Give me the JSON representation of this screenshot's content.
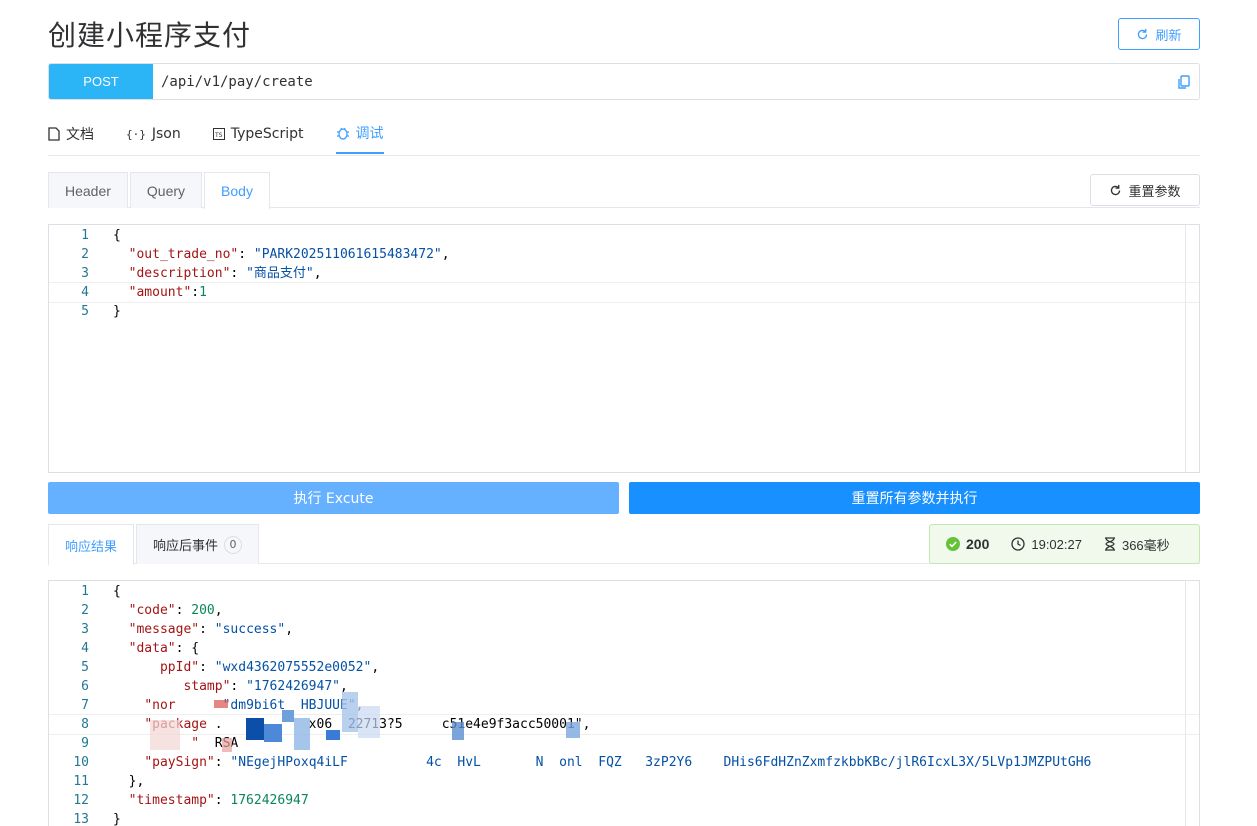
{
  "header": {
    "title": "创建小程序支付",
    "refresh_label": "刷新"
  },
  "request": {
    "method": "POST",
    "url": "/api/v1/pay/create"
  },
  "main_tabs": [
    {
      "label": "文档",
      "icon": "document-icon"
    },
    {
      "label": "Json",
      "icon": "braces-icon"
    },
    {
      "label": "TypeScript",
      "icon": "ts-icon"
    },
    {
      "label": "调试",
      "icon": "bug-icon",
      "active": true
    }
  ],
  "param_tabs": [
    {
      "label": "Header"
    },
    {
      "label": "Query"
    },
    {
      "label": "Body",
      "active": true
    }
  ],
  "reset_params_label": "重置参数",
  "body_editor": {
    "line_numbers": [
      "1",
      "2",
      "3",
      "4",
      "5"
    ]
  },
  "actions": {
    "execute_label": "执行 Excute",
    "reset_execute_label": "重置所有参数并执行"
  },
  "response_tabs": [
    {
      "label": "响应结果",
      "active": true
    },
    {
      "label": "响应后事件",
      "badge": "0"
    }
  ],
  "status": {
    "code": "200",
    "time": "19:02:27",
    "duration": "366毫秒",
    "color": "#67c23a"
  },
  "response_editor": {
    "line_numbers": [
      "1",
      "2",
      "3",
      "4",
      "5",
      "6",
      "7",
      "8",
      "9",
      "10",
      "11",
      "12",
      "13"
    ]
  },
  "colors": {
    "accent": "#409eff",
    "method_bg": "#2bb4f6",
    "execute_bg": "#66b1ff",
    "execute_all_bg": "#1890ff"
  }
}
